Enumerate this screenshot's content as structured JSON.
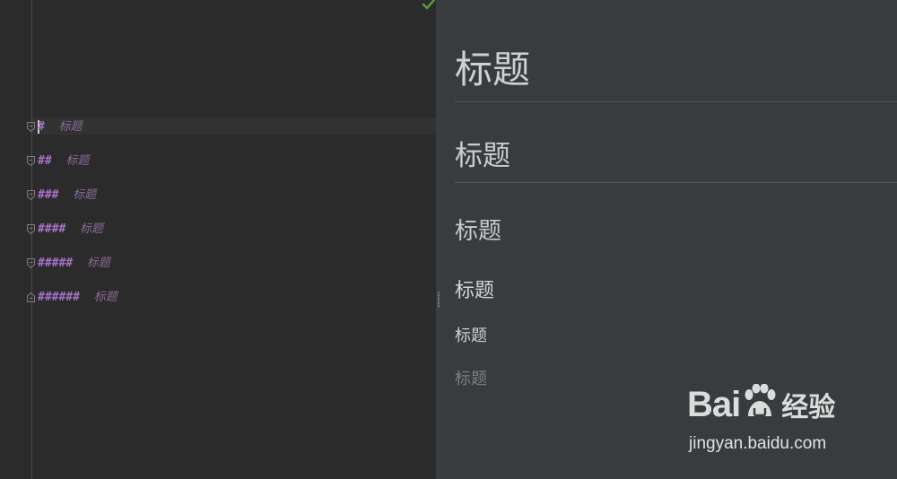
{
  "editor": {
    "lines": [
      {
        "hashes": "#",
        "text": "标题"
      },
      {
        "hashes": "##",
        "text": "标题"
      },
      {
        "hashes": "###",
        "text": "标题"
      },
      {
        "hashes": "####",
        "text": "标题"
      },
      {
        "hashes": "#####",
        "text": "标题"
      },
      {
        "hashes": "######",
        "text": "标题"
      }
    ],
    "status_icon": "checkmark-icon",
    "status_color": "#5a9e3c"
  },
  "preview": {
    "h1": "标题",
    "h2": "标题",
    "h3": "标题",
    "h4": "标题",
    "h5": "标题",
    "h6": "标题"
  },
  "watermark": {
    "brand_left": "Bai",
    "brand_right": "经验",
    "url": "jingyan.baidu.com"
  }
}
